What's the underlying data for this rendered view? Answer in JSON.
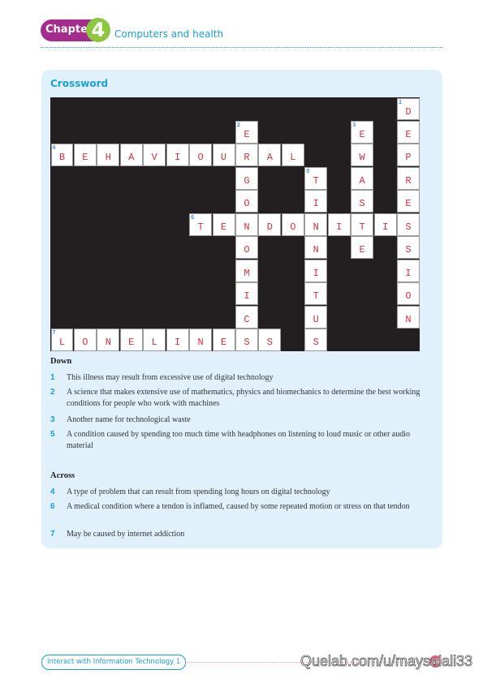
{
  "header": {
    "chapter_label": "Chapter",
    "chapter_number": "4",
    "chapter_title": "Computers and health"
  },
  "panel": {
    "title": "Crossword"
  },
  "crossword": {
    "rows": 11,
    "cols": 16,
    "words": [
      {
        "number": "1",
        "direction": "down",
        "row": 0,
        "col": 15,
        "answer": "DEPRESSION"
      },
      {
        "number": "2",
        "direction": "down",
        "row": 1,
        "col": 8,
        "answer": "ERGONOMICS"
      },
      {
        "number": "3",
        "direction": "down",
        "row": 1,
        "col": 13,
        "answer": "EWASTE"
      },
      {
        "number": "4",
        "direction": "across",
        "row": 2,
        "col": 0,
        "answer": "BEHAVIOURAL"
      },
      {
        "number": "5",
        "direction": "down",
        "row": 3,
        "col": 11,
        "answer": "TINNITUS"
      },
      {
        "number": "6",
        "direction": "across",
        "row": 5,
        "col": 6,
        "answer": "TENDONITIS"
      },
      {
        "number": "7",
        "direction": "across",
        "row": 10,
        "col": 0,
        "answer": "LONELINESS"
      }
    ]
  },
  "clues": {
    "down_heading": "Down",
    "down": [
      {
        "number": "1",
        "text": "This illness may result from excessive use of digital technology"
      },
      {
        "number": "2",
        "text": "A science that makes extensive use of mathematics, physics and biomechanics to determine the best working conditions for people who work with machines"
      },
      {
        "number": "3",
        "text": "Another name for technological waste"
      },
      {
        "number": "5",
        "text": "A condition caused by spending too much time with headphones on listening to loud music or other audio material"
      }
    ],
    "across_heading": "Across",
    "across": [
      {
        "number": "4",
        "text": "A type of problem that can result from spending long hours on digital technology"
      },
      {
        "number": "6",
        "text": "A medical condition where a tendon is inflamed, caused by some repeated motion or stress on that tendon"
      },
      {
        "number": "7",
        "text": "May be caused by internet addiction"
      }
    ]
  },
  "footer": {
    "book_title": "Interact with Information Technology 1",
    "page_number": "55",
    "watermark": "Quelab.com/u/maysalali33"
  }
}
